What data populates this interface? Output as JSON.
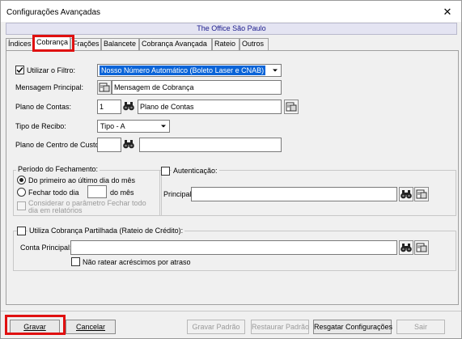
{
  "window": {
    "title": "Configurações Avançadas",
    "close_glyph": "✕"
  },
  "company": "The Office São Paulo",
  "tabs": [
    "Índices",
    "Cobrança",
    "Frações",
    "Balancete",
    "Cobrança Avançada",
    "Rateio",
    "Outros"
  ],
  "active_tab": "Cobrança",
  "form": {
    "utilizar_filtro_label": "Utilizar o Filtro:",
    "filtro_value": "Nosso Número Automático (Boleto Laser e CNAB)",
    "mensagem_label": "Mensagem Principal:",
    "mensagem_value": "Mensagem de Cobrança",
    "plano_contas_label": "Plano de Contas:",
    "plano_contas_code": "1",
    "plano_contas_desc": "Plano de Contas",
    "tipo_recibo_label": "Tipo de Recibo:",
    "tipo_recibo_value": "Tipo - A",
    "plano_centro_label": "Plano de Centro de Custo:",
    "plano_centro_code": "",
    "plano_centro_desc": ""
  },
  "periodo": {
    "legend": "Período do Fechamento:",
    "option1": "Do primeiro ao último dia do mês",
    "option2_prefix": "Fechar todo dia",
    "option2_day": "",
    "option2_suffix": "do mês",
    "considerar": "Considerar o parâmetro Fechar todo dia em relatórios"
  },
  "autenticacao": {
    "legend": "Autenticação:",
    "principal_label": "Principal:",
    "principal_value": ""
  },
  "partilhada": {
    "legend": "Utiliza Cobrança Partilhada (Rateio de Crédito):",
    "conta_label": "Conta Principal:",
    "conta_value": "",
    "nao_ratear": "Não ratear acréscimos por atraso"
  },
  "buttons": {
    "gravar": "Gravar",
    "cancelar": "Cancelar",
    "gravar_padrao": "Gravar Padrão",
    "restaurar_padrao": "Restaurar Padrão",
    "resgatar": "Resgatar Configurações",
    "sair": "Sair"
  },
  "icons": {
    "binoculars": "binoculars-icon",
    "settings": "settings-icon",
    "check": "checkmark-icon",
    "dropdown": "chevron-down-icon"
  },
  "colors": {
    "highlight_red": "#e01010",
    "selection_blue": "#0a64d8",
    "company_text": "#1a1a8c"
  }
}
